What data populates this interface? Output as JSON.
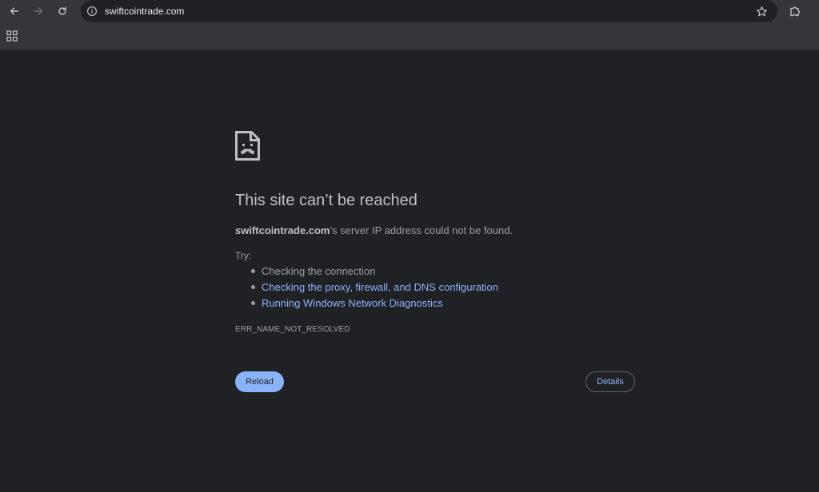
{
  "browser": {
    "url": "swiftcointrade.com",
    "icons": {
      "back": "back-arrow-icon",
      "forward": "forward-arrow-icon",
      "reload": "reload-icon",
      "site_info": "info-icon",
      "bookmark": "star-icon",
      "extensions": "puzzle-icon",
      "apps": "apps-grid-icon"
    }
  },
  "error_page": {
    "icon": "sad-page-icon",
    "title": "This site can’t be reached",
    "description_host": "swiftcointrade.com",
    "description_rest": "’s server IP address could not be found.",
    "try_label": "Try:",
    "suggestions": [
      {
        "text": "Checking the connection"
      },
      {
        "text": "Checking the proxy, firewall, and DNS configuration"
      },
      {
        "text": "Running Windows Network Diagnostics"
      }
    ],
    "error_code": "ERR_NAME_NOT_RESOLVED",
    "reload_label": "Reload",
    "details_label": "Details"
  },
  "colors": {
    "page_background": "#202124",
    "toolbar_background": "#35363a",
    "link": "#8ab4f8",
    "text": "#bdc1c6"
  }
}
